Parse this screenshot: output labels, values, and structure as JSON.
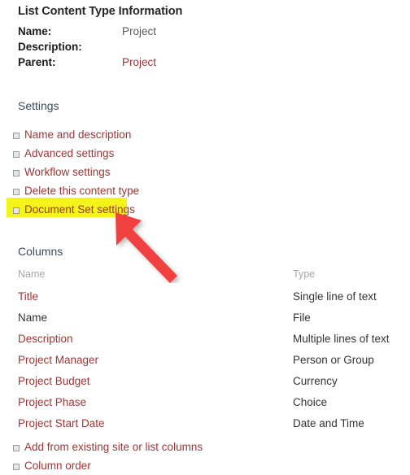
{
  "header": {
    "title": "List Content Type Information",
    "fields": [
      {
        "label": "Name:",
        "value": "Project",
        "is_link": false
      },
      {
        "label": "Description:",
        "value": "",
        "is_link": false
      },
      {
        "label": "Parent:",
        "value": "Project",
        "is_link": true
      }
    ]
  },
  "settings": {
    "heading": "Settings",
    "links": [
      {
        "label": "Name and description",
        "highlighted": false
      },
      {
        "label": "Advanced settings",
        "highlighted": false
      },
      {
        "label": "Workflow settings",
        "highlighted": false
      },
      {
        "label": "Delete this content type",
        "highlighted": false
      },
      {
        "label": "Document Set settings",
        "highlighted": true
      }
    ]
  },
  "columns": {
    "heading": "Columns",
    "table_headers": {
      "name": "Name",
      "type": "Type"
    },
    "rows": [
      {
        "name": "Title",
        "type": "Single line of text",
        "is_link": true
      },
      {
        "name": "Name",
        "type": "File",
        "is_link": false
      },
      {
        "name": "Description",
        "type": "Multiple lines of text",
        "is_link": true
      },
      {
        "name": "Project Manager",
        "type": "Person or Group",
        "is_link": true
      },
      {
        "name": "Project Budget",
        "type": "Currency",
        "is_link": true
      },
      {
        "name": "Project Phase",
        "type": "Choice",
        "is_link": true
      },
      {
        "name": "Project Start Date",
        "type": "Date and Time",
        "is_link": true
      }
    ],
    "links": [
      {
        "label": "Add from existing site or list columns"
      },
      {
        "label": "Column order"
      }
    ]
  },
  "annotation": {
    "arrow": {
      "name": "red-arrow-pointing-to-document-set-settings",
      "color": "#f04040"
    }
  },
  "theme": {
    "link_color": "#9b3535",
    "highlight_color": "#f4f41c",
    "heading_color": "#3b4a57",
    "muted_color": "#a6a6a6",
    "arrow_color": "#f04040"
  }
}
